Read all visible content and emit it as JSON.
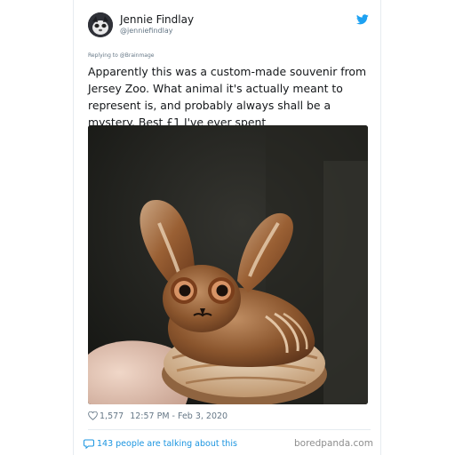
{
  "tweet": {
    "author_name": "Jennie Findlay",
    "author_handle": "@jenniefindlay",
    "replying_to": "Replying to @Brainmage",
    "text": "Apparently this was a custom-made souvenir from Jersey Zoo. What animal it's actually meant to represent is, and probably always shall be a mystery. Best £1 I've ever spent",
    "like_count": "1,577",
    "timestamp": "12:57 PM - Feb 3, 2020",
    "conversation": "143 people are talking about this"
  },
  "watermark": "boredpanda.com",
  "icons": {
    "brand": "twitter-icon",
    "like": "heart-icon",
    "reply": "speech-bubble-icon"
  },
  "colors": {
    "twitter_blue": "#1da1f2",
    "link_blue": "#1b95e0",
    "secondary_text": "#657786",
    "primary_text": "#14171a"
  }
}
